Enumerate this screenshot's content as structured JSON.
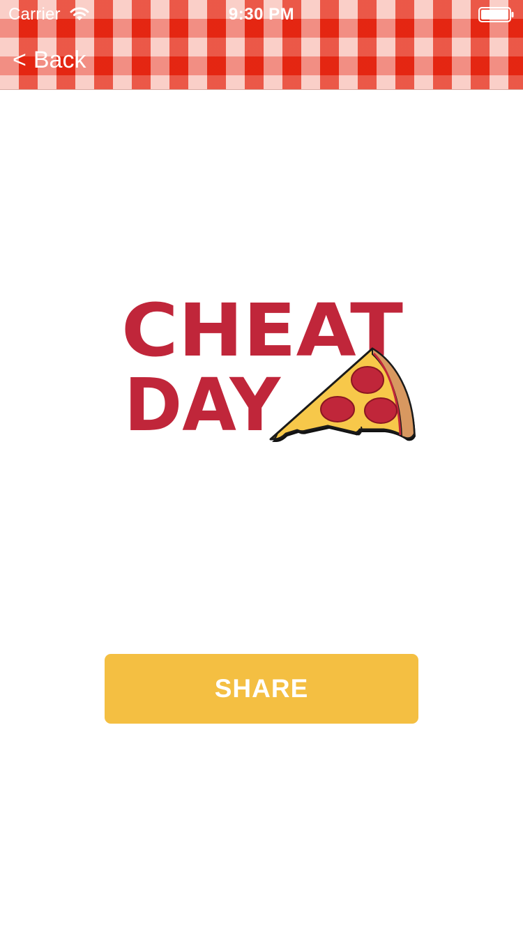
{
  "status_bar": {
    "carrier": "Carrier",
    "time": "9:30 PM",
    "wifi_icon": "wifi-icon",
    "battery_icon": "battery-full-icon"
  },
  "nav": {
    "back_chevron": "<",
    "back_label": "Back",
    "background_pattern": "red-gingham"
  },
  "logo": {
    "line1": "CHEAT",
    "line2": "DAY",
    "icon": "pizza-slice-icon",
    "text_color": "#c0263a"
  },
  "share_button": {
    "label": "SHARE",
    "color": "#f4bf42"
  }
}
